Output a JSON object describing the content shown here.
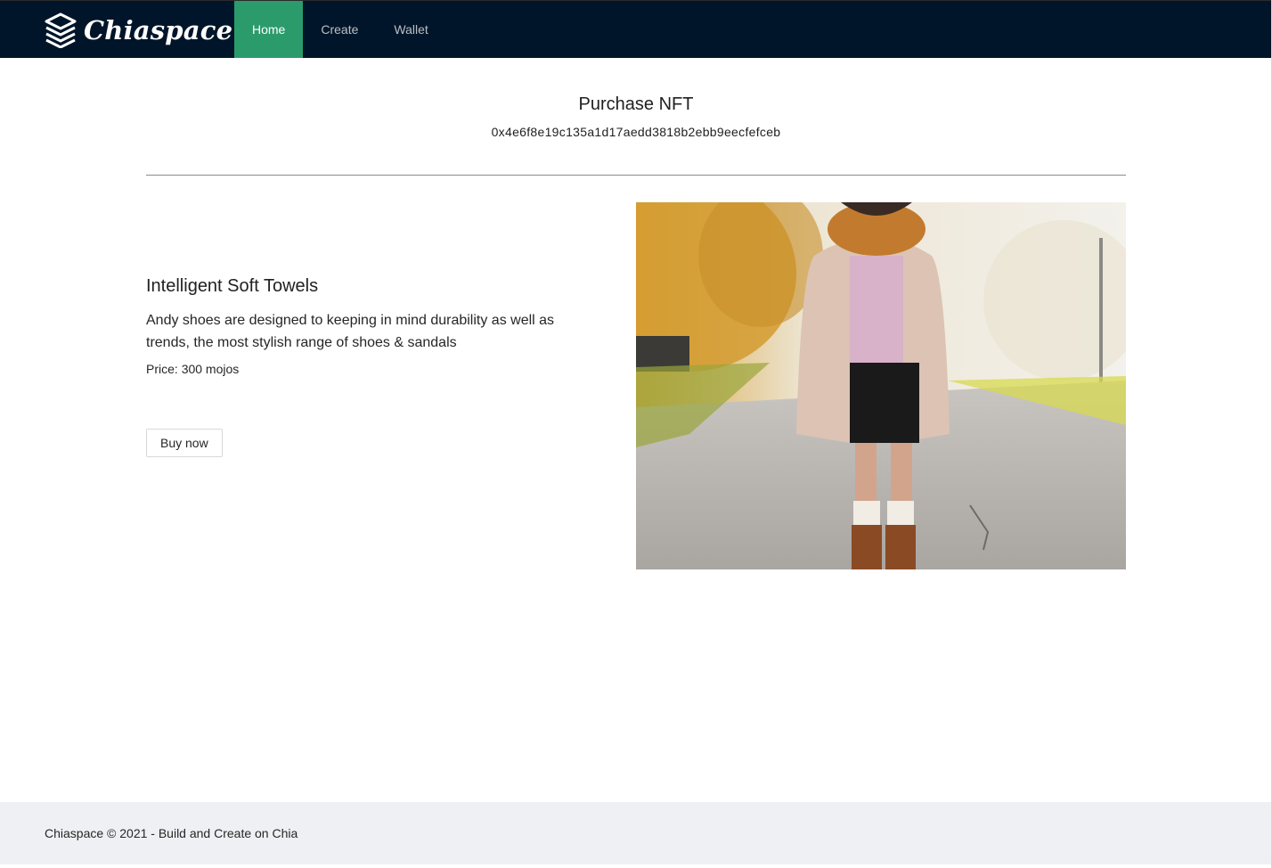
{
  "brand": {
    "name": "Chiaspace",
    "logo_icon": "stack-layers-icon"
  },
  "nav": {
    "items": [
      {
        "label": "Home",
        "active": true
      },
      {
        "label": "Create",
        "active": false
      },
      {
        "label": "Wallet",
        "active": false
      }
    ]
  },
  "page": {
    "title": "Purchase NFT",
    "nft_id": "0x4e6f8e19c135a1d17aedd3818b2ebb9eecfefceb"
  },
  "product": {
    "name": "Intelligent Soft Towels",
    "description": "Andy shoes are designed to keeping in mind durability as well as trends, the most stylish range of shoes & sandals",
    "price_label": "Price:",
    "price_value": "300 mojos",
    "buy_label": "Buy now"
  },
  "footer": {
    "text": "Chiaspace © 2021 - Build and Create on Chia"
  },
  "colors": {
    "nav_bg": "#001529",
    "active_tab": "#2b9b6c",
    "footer_bg": "#eff0f3"
  }
}
